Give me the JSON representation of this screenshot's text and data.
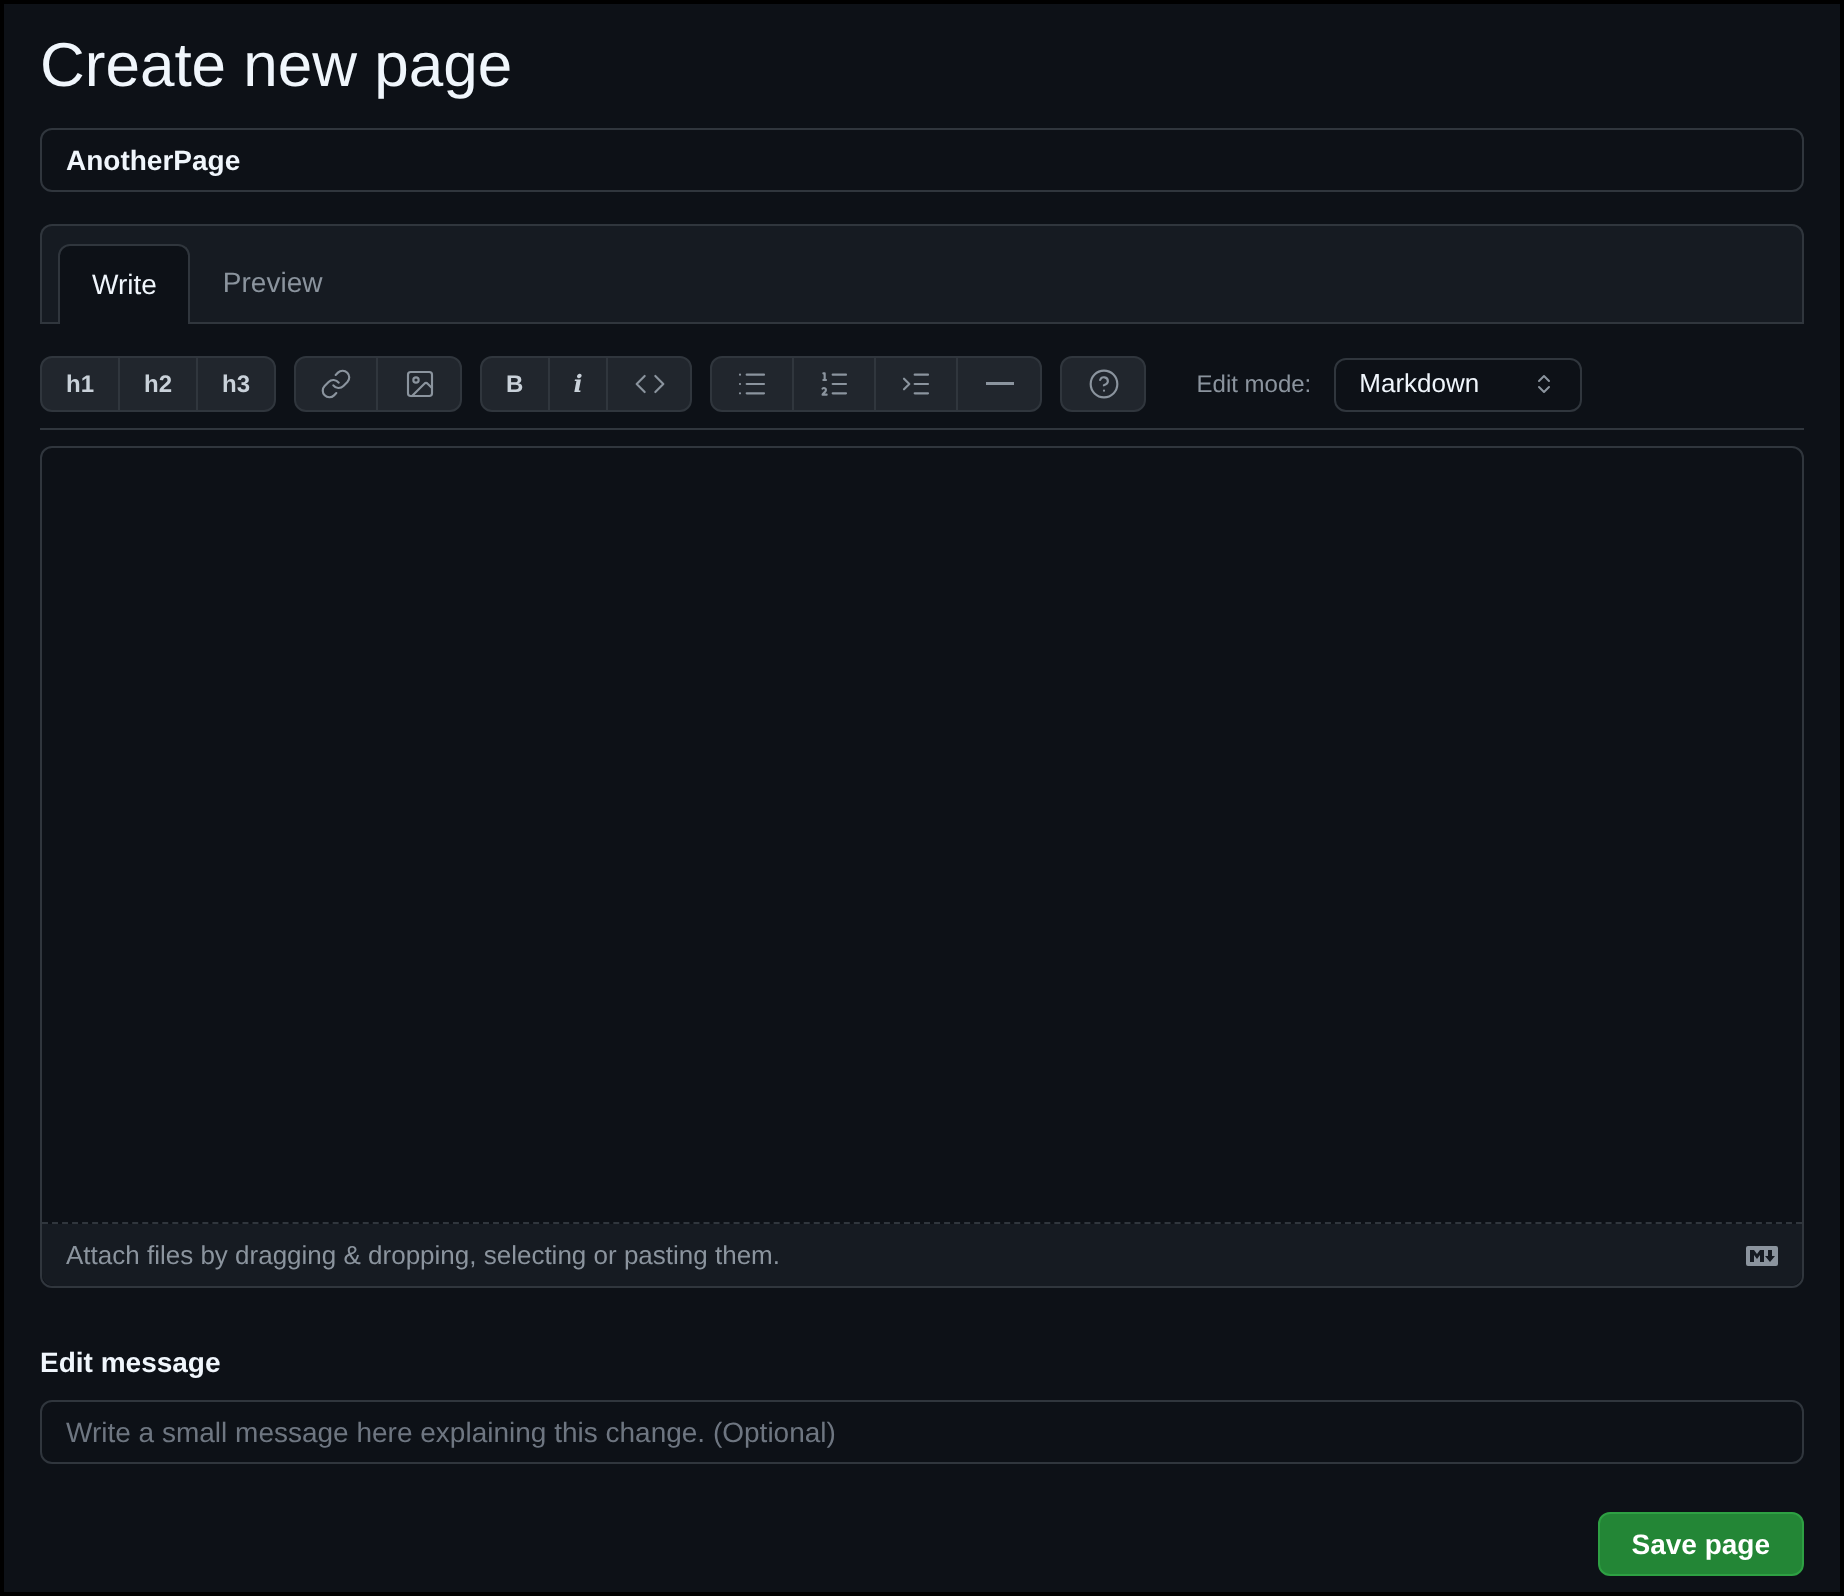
{
  "title": "Create new page",
  "page_name": {
    "value": "AnotherPage"
  },
  "tabs": [
    {
      "label": "Write",
      "selected": true
    },
    {
      "label": "Preview",
      "selected": false
    }
  ],
  "toolbar": [
    {
      "buttons": [
        {
          "kind": "text",
          "label": "h1"
        },
        {
          "kind": "text",
          "label": "h2"
        },
        {
          "kind": "text",
          "label": "h3"
        }
      ]
    },
    {
      "buttons": [
        {
          "kind": "link"
        },
        {
          "kind": "image"
        }
      ]
    },
    {
      "buttons": [
        {
          "kind": "bold",
          "label": "B"
        },
        {
          "kind": "italic",
          "label": "i"
        },
        {
          "kind": "code"
        }
      ]
    },
    {
      "buttons": [
        {
          "kind": "bullets"
        },
        {
          "kind": "numbers"
        },
        {
          "kind": "indent"
        },
        {
          "kind": "rule"
        }
      ]
    },
    {
      "buttons": [
        {
          "kind": "help"
        }
      ]
    }
  ],
  "edit_mode": {
    "label": "Edit mode:",
    "value": "Markdown"
  },
  "attach_hint": "Attach files by dragging & dropping, selecting or pasting them.",
  "edit_message": {
    "label": "Edit message",
    "placeholder": "Write a small message here explaining this change. (Optional)"
  },
  "save_button": "Save page"
}
